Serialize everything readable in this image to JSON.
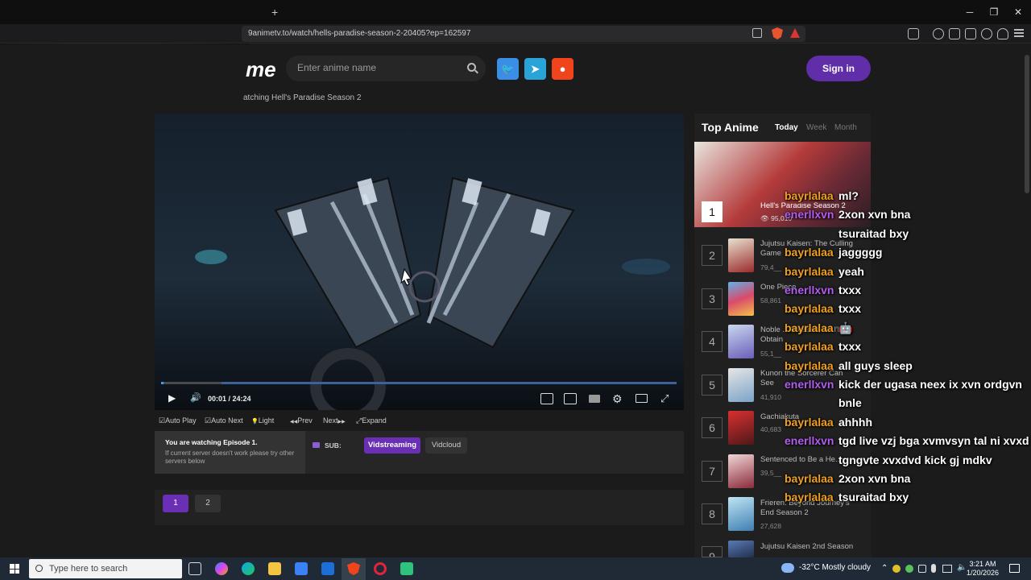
{
  "browser": {
    "new_tab": "+",
    "url": "9animetv.to/watch/hells-paradise-season-2-20405?ep=162597",
    "win_min": "─",
    "win_max": "❐",
    "win_close": "✕"
  },
  "site": {
    "logo": "me",
    "search_placeholder": "Enter anime name",
    "social": {
      "twitter": "🐦",
      "telegram": "➤",
      "reddit": "●"
    },
    "signin": "Sign in",
    "breadcrumb": "atching Hell's Paradise Season 2"
  },
  "player": {
    "time": "00:01  /  24:24",
    "progress_fraction": 0.0007,
    "play_icon": "▶",
    "volume_icon": "🔊"
  },
  "options": [
    {
      "label": "Auto Play",
      "icon": "☑"
    },
    {
      "label": "Auto Next",
      "icon": "☑"
    },
    {
      "label": "Light",
      "icon": "💡"
    },
    {
      "label": "Prev",
      "icon": "◀◀"
    },
    {
      "label": "Next",
      "icon": "▶▶"
    },
    {
      "label": "Expand",
      "icon": "⤢"
    }
  ],
  "servers": {
    "episode_title": "You are watching Episode 1.",
    "episode_note": "If current server doesn't work please try other servers below",
    "sub_label": "SUB:",
    "buttons": [
      "Vidstreaming",
      "Vidcloud"
    ]
  },
  "episodes": [
    "1",
    "2"
  ],
  "top_anime": {
    "title": "Top Anime",
    "tabs": [
      "Today",
      "Week",
      "Month"
    ],
    "items": [
      {
        "rank": "1",
        "name": "Hell's Paradise Season 2",
        "views": "95,010"
      },
      {
        "rank": "2",
        "name": "Jujutsu Kaisen: The Culling Game",
        "views": "79,4__"
      },
      {
        "rank": "3",
        "name": "One Piece",
        "views": "58,861"
      },
      {
        "rank": "4",
        "name": "Noble ... Blessed, So I'll Obtain",
        "views": "55,1__"
      },
      {
        "rank": "5",
        "name": "Kunon the Sorcerer Can See",
        "views": "41,910"
      },
      {
        "rank": "6",
        "name": "Gachiakuta",
        "views": "40,683"
      },
      {
        "rank": "7",
        "name": "Sentenced to Be a He...",
        "views": "39,5__"
      },
      {
        "rank": "8",
        "name": "Frieren: Beyond Journey's End Season 2",
        "views": "27,628"
      },
      {
        "rank": "9",
        "name": "Jujutsu Kaisen 2nd Season",
        "views": "26,745"
      }
    ]
  },
  "chat": [
    {
      "user": "bayrlalaa",
      "msg": "ml?",
      "type": "b"
    },
    {
      "user": "enerllxvn",
      "msg": "2xon xvn bna",
      "type": "e"
    },
    {
      "user": "",
      "msg": "tsuraitad bxy",
      "type": "b"
    },
    {
      "user": "bayrlalaa",
      "msg": "jaggggg",
      "type": "b"
    },
    {
      "user": "bayrlalaa",
      "msg": "yeah",
      "type": "b"
    },
    {
      "user": "enerllxvn",
      "msg": "txxx",
      "type": "e"
    },
    {
      "user": "bayrlalaa",
      "msg": "txxx",
      "type": "b"
    },
    {
      "user": "bayrlalaa",
      "msg": "🤖",
      "type": "b"
    },
    {
      "user": "bayrlalaa",
      "msg": "txxx",
      "type": "b"
    },
    {
      "user": "bayrlalaa",
      "msg": "all guys sleep",
      "type": "b"
    },
    {
      "user": "enerllxvn",
      "msg": "kick der ugasa neex ix xvn ordgvn",
      "type": "e"
    },
    {
      "user": "",
      "msg": "bnle",
      "type": "e"
    },
    {
      "user": "bayrlalaa",
      "msg": "ahhhh",
      "type": "b"
    },
    {
      "user": "enerllxvn",
      "msg": "tgd live vzj bga xvmvsyn tal ni xvxd",
      "type": "e"
    },
    {
      "user": "",
      "msg": "tgngvte xvxdvd kick gj mdkv",
      "type": "e"
    },
    {
      "user": "bayrlalaa",
      "msg": "2xon xvn bna",
      "type": "b"
    },
    {
      "user": "bayrlalaa",
      "msg": "tsuraitad bxy",
      "type": "b"
    }
  ],
  "taskbar": {
    "search_placeholder": "Type here to search",
    "weather": "-32°C  Mostly cloudy",
    "time": "3:21 AM",
    "date": "1/20/2026"
  },
  "colors": {
    "accent": "#5f2ea8",
    "active_server": "#6a2fb5",
    "chat_user_b": "#f0a020",
    "chat_user_e": "#b25cf0"
  }
}
